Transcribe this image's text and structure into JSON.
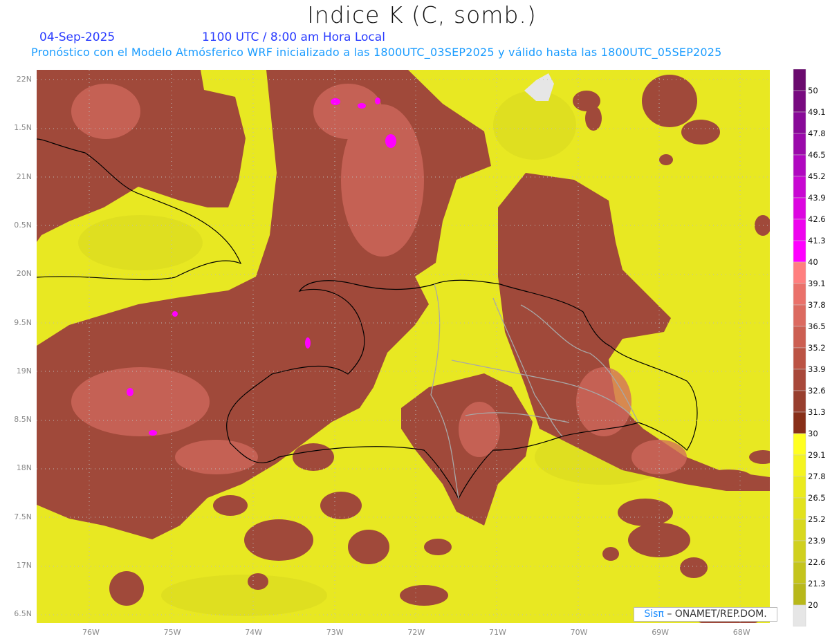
{
  "title": "Indice K (C, somb.)",
  "date": "04-Sep-2025",
  "time": "1100 UTC / 8:00 am Hora Local",
  "subtitle": "Pronóstico con el Modelo Atmósferico WRF inicializado a las 1800UTC_03SEP2025 y válido hasta las  1800UTC_05SEP2025",
  "lat_labels": [
    "22N",
    "1.5N",
    "21N",
    "0.5N",
    "20N",
    "9.5N",
    "19N",
    "8.5N",
    "18N",
    "7.5N",
    "17N",
    "6.5N"
  ],
  "lon_labels": [
    "76W",
    "75W",
    "74W",
    "73W",
    "72W",
    "71W",
    "70W",
    "69W",
    "68W"
  ],
  "credit": {
    "logo": "Sisπ",
    "text": "– ONAMET/REP.DOM."
  },
  "colorbar": {
    "labels": [
      "50",
      "49.1",
      "47.8",
      "46.5",
      "45.2",
      "43.9",
      "42.6",
      "41.3",
      "40",
      "39.1",
      "37.8",
      "36.5",
      "35.2",
      "33.9",
      "32.6",
      "31.3",
      "30",
      "29.1",
      "27.8",
      "26.5",
      "25.2",
      "23.9",
      "22.6",
      "21.3",
      "20"
    ],
    "colors": [
      "#6a0a6e",
      "#780a80",
      "#880a98",
      "#9a0aaa",
      "#b008c0",
      "#c808d2",
      "#dc06e0",
      "#ee04ee",
      "#ff00ff",
      "#ff7f7f",
      "#ea716a",
      "#dc6a60",
      "#cc5f52",
      "#bb5344",
      "#a8483a",
      "#983f2e",
      "#882f18",
      "#ffff20",
      "#f4f420",
      "#eaea1e",
      "#e2e21e",
      "#d8d81e",
      "#d0d01e",
      "#c4c41c",
      "#b8b81a",
      "#e6e6e6"
    ]
  },
  "field_colors": {
    "yellow": "#eaea22",
    "brown": "#a0493a",
    "salmon": "#d26a5e",
    "magenta": "#ff00ff",
    "missing": "#e6e6e6"
  }
}
